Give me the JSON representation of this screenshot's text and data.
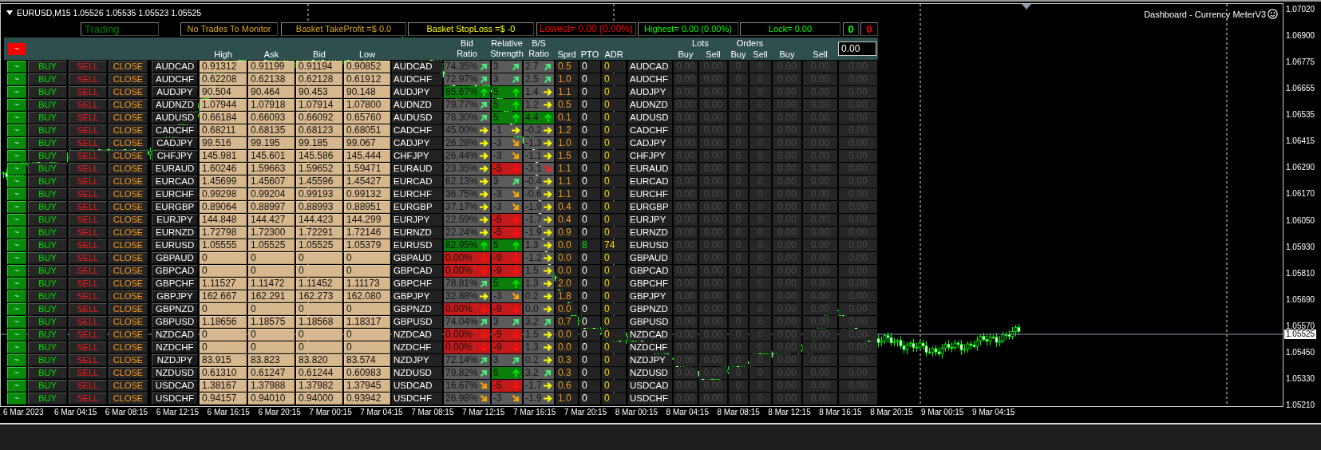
{
  "title": "EURUSD,M15 1.05526 1.05535 1.05523 1.05525",
  "indicator_label": "Dashboard - Currency MeterV3",
  "status": [
    {
      "text": "Trading",
      "color": "#008000"
    },
    {
      "text": "No Trades To Monitor",
      "color": "#d9a520"
    },
    {
      "text": "Basket TakeProfit =$ 0.0",
      "color": "#d9a520"
    },
    {
      "text": "Basket StopLoss =$ -0",
      "color": "#ffff00"
    },
    {
      "text": "Lowest= 0.00 (0.00%)",
      "color": "#ff0000"
    },
    {
      "text": "Highest= 0.00 (0.00%)",
      "color": "#00ff00"
    },
    {
      "text": "Lock= 0.00",
      "color": "#00ff00"
    },
    {
      "text": "0",
      "color": "#00ff00"
    },
    {
      "text": "0",
      "color": "#ff0000"
    }
  ],
  "header": {
    "menu_button": "~",
    "columns": [
      "High",
      "Ask",
      "Bid",
      "Low",
      "Bid Ratio",
      "Relative Strength",
      "B/S Ratio",
      "Sprd",
      "PTO",
      "ADR"
    ],
    "lots": {
      "title": "Lots",
      "columns": [
        "Buy",
        "Sell"
      ]
    },
    "orders": {
      "title": "Orders",
      "columns": [
        "Buy",
        "Sell"
      ]
    },
    "totals": [
      "Buy",
      "Sell"
    ],
    "input_value": "0.00"
  },
  "rows": [
    {
      "buttons": [
        "~",
        "BUY",
        "SELL",
        "CLOSE"
      ],
      "symbol": "AUDCAD",
      "high": "0.91312",
      "ask": "0.91199",
      "bid": "0.91194",
      "low": "0.90852",
      "symbol_2": "AUDCAD",
      "bid_ratio": {
        "text": "74.35%",
        "kind": "rise",
        "color": "#5b5b5b"
      },
      "strength": {
        "text": "3",
        "kind": "rise",
        "color": "#5b5b5b"
      },
      "bs_ratio": {
        "text": "2.7",
        "kind": "rise",
        "color": "#5b5b5b"
      },
      "sprd": "0.5",
      "pto": "0",
      "pto_active": false,
      "adr": "0",
      "symbol_3": "AUDCAD",
      "trades": [
        "0.00",
        "0.00",
        "0",
        "0",
        "0.00",
        "0.00",
        "0.00"
      ]
    },
    {
      "buttons": [
        "~",
        "BUY",
        "SELL",
        "CLOSE"
      ],
      "symbol": "AUDCHF",
      "high": "0.62208",
      "ask": "0.62138",
      "bid": "0.62128",
      "low": "0.61912",
      "symbol_2": "AUDCHF",
      "bid_ratio": {
        "text": "72.97%",
        "kind": "rise",
        "color": "#5b5b5b"
      },
      "strength": {
        "text": "3",
        "kind": "rise",
        "color": "#5b5b5b"
      },
      "bs_ratio": {
        "text": "2.5",
        "kind": "rise",
        "color": "#5b5b5b"
      },
      "sprd": "1.0",
      "pto": "0",
      "pto_active": false,
      "adr": "0",
      "symbol_3": "AUDCHF",
      "trades": [
        "0.00",
        "0.00",
        "0",
        "0",
        "0.00",
        "0.00",
        "0.00"
      ]
    },
    {
      "buttons": [
        "~",
        "BUY",
        "SELL",
        "CLOSE"
      ],
      "symbol": "AUDJPY",
      "high": "90.504",
      "ask": "90.464",
      "bid": "90.453",
      "low": "90.148",
      "symbol_2": "AUDJPY",
      "bid_ratio": {
        "text": "85.67%",
        "kind": "up",
        "color": "#0b7e0b"
      },
      "strength": {
        "text": "5",
        "kind": "up",
        "color": "#0b7e0b"
      },
      "bs_ratio": {
        "text": "1.4",
        "kind": "flat",
        "color": "#5b5b5b"
      },
      "sprd": "1.1",
      "pto": "0",
      "pto_active": false,
      "adr": "0",
      "symbol_3": "AUDJPY",
      "trades": [
        "0.00",
        "0.00",
        "0",
        "0",
        "0.00",
        "0.00",
        "0.00"
      ]
    },
    {
      "buttons": [
        "~",
        "BUY",
        "SELL",
        "CLOSE"
      ],
      "symbol": "AUDNZD",
      "high": "1.07944",
      "ask": "1.07918",
      "bid": "1.07914",
      "low": "1.07800",
      "symbol_2": "AUDNZD",
      "bid_ratio": {
        "text": "79.77%",
        "kind": "rise",
        "color": "#5b5b5b"
      },
      "strength": {
        "text": "5",
        "kind": "up",
        "color": "#0b7e0b"
      },
      "bs_ratio": {
        "text": "1.2",
        "kind": "flat",
        "color": "#5b5b5b"
      },
      "sprd": "0.5",
      "pto": "0",
      "pto_active": false,
      "adr": "0",
      "symbol_3": "AUDNZD",
      "trades": [
        "0.00",
        "0.00",
        "0",
        "0",
        "0.00",
        "0.00",
        "0.00"
      ]
    },
    {
      "buttons": [
        "~",
        "BUY",
        "SELL",
        "CLOSE"
      ],
      "symbol": "AUDUSD",
      "high": "0.66184",
      "ask": "0.66093",
      "bid": "0.66092",
      "low": "0.65760",
      "symbol_2": "AUDUSD",
      "bid_ratio": {
        "text": "78.30%",
        "kind": "rise",
        "color": "#5b5b5b"
      },
      "strength": {
        "text": "5",
        "kind": "up",
        "color": "#0b7e0b"
      },
      "bs_ratio": {
        "text": "4.4",
        "kind": "up",
        "color": "#0b7e0b"
      },
      "sprd": "0.1",
      "pto": "0",
      "pto_active": false,
      "adr": "0",
      "symbol_3": "AUDUSD",
      "trades": [
        "0.00",
        "0.00",
        "0",
        "0",
        "0.00",
        "0.00",
        "0.00"
      ]
    },
    {
      "buttons": [
        "~",
        "BUY",
        "SELL",
        "CLOSE"
      ],
      "symbol": "CADCHF",
      "high": "0.68211",
      "ask": "0.68135",
      "bid": "0.68123",
      "low": "0.68051",
      "symbol_2": "CADCHF",
      "bid_ratio": {
        "text": "45.00%",
        "kind": "flat",
        "color": "#5b5b5b"
      },
      "strength": {
        "text": "-1",
        "kind": "flat",
        "color": "#5b5b5b"
      },
      "bs_ratio": {
        "text": "-0.2",
        "kind": "flat",
        "color": "#5b5b5b"
      },
      "sprd": "1.2",
      "pto": "0",
      "pto_active": false,
      "adr": "0",
      "symbol_3": "CADCHF",
      "trades": [
        "0.00",
        "0.00",
        "0",
        "0",
        "0.00",
        "0.00",
        "0.00"
      ]
    },
    {
      "buttons": [
        "~",
        "BUY",
        "SELL",
        "CLOSE"
      ],
      "symbol": "CADJPY",
      "high": "99.516",
      "ask": "99.195",
      "bid": "99.185",
      "low": "99.067",
      "symbol_2": "CADJPY",
      "bid_ratio": {
        "text": "26.28%",
        "kind": "flat",
        "color": "#5b5b5b"
      },
      "strength": {
        "text": "-3",
        "kind": "ease",
        "color": "#5b5b5b"
      },
      "bs_ratio": {
        "text": "-1.3",
        "kind": "flat",
        "color": "#5b5b5b"
      },
      "sprd": "1.0",
      "pto": "0",
      "pto_active": false,
      "adr": "0",
      "symbol_3": "CADJPY",
      "trades": [
        "0.00",
        "0.00",
        "0",
        "0",
        "0.00",
        "0.00",
        "0.00"
      ]
    },
    {
      "buttons": [
        "~",
        "BUY",
        "SELL",
        "CLOSE"
      ],
      "symbol": "CHFJPY",
      "high": "145.981",
      "ask": "145.601",
      "bid": "145.586",
      "low": "145.444",
      "symbol_2": "CHFJPY",
      "bid_ratio": {
        "text": "26.44%",
        "kind": "flat",
        "color": "#5b5b5b"
      },
      "strength": {
        "text": "-3",
        "kind": "ease",
        "color": "#5b5b5b"
      },
      "bs_ratio": {
        "text": "-1.1",
        "kind": "flat",
        "color": "#5b5b5b"
      },
      "sprd": "1.5",
      "pto": "0",
      "pto_active": false,
      "adr": "0",
      "symbol_3": "CHFJPY",
      "trades": [
        "0.00",
        "0.00",
        "0",
        "0",
        "0.00",
        "0.00",
        "0.00"
      ]
    },
    {
      "buttons": [
        "~",
        "BUY",
        "SELL",
        "CLOSE"
      ],
      "symbol": "EURAUD",
      "high": "1.60246",
      "ask": "1.59663",
      "bid": "1.59652",
      "low": "1.59471",
      "symbol_2": "EURAUD",
      "bid_ratio": {
        "text": "23.35%",
        "kind": "flat",
        "color": "#5b5b5b"
      },
      "strength": {
        "text": "-5",
        "kind": "down",
        "color": "#c41a1a"
      },
      "bs_ratio": {
        "text": "-3.1",
        "kind": "fall",
        "color": "#5b5b5b"
      },
      "sprd": "1.1",
      "pto": "0",
      "pto_active": false,
      "adr": "0",
      "symbol_3": "EURAUD",
      "trades": [
        "0.00",
        "0.00",
        "0",
        "0",
        "0.00",
        "0.00",
        "0.00"
      ]
    },
    {
      "buttons": [
        "~",
        "BUY",
        "SELL",
        "CLOSE"
      ],
      "symbol": "EURCAD",
      "high": "1.45699",
      "ask": "1.45607",
      "bid": "1.45596",
      "low": "1.45427",
      "symbol_2": "EURCAD",
      "bid_ratio": {
        "text": "62.13%",
        "kind": "flat",
        "color": "#5b5b5b"
      },
      "strength": {
        "text": "3",
        "kind": "rise",
        "color": "#5b5b5b"
      },
      "bs_ratio": {
        "text": "-0.4",
        "kind": "flat",
        "color": "#5b5b5b"
      },
      "sprd": "1.1",
      "pto": "0",
      "pto_active": false,
      "adr": "0",
      "symbol_3": "EURCAD",
      "trades": [
        "0.00",
        "0.00",
        "0",
        "0",
        "0.00",
        "0.00",
        "0.00"
      ]
    },
    {
      "buttons": [
        "~",
        "BUY",
        "SELL",
        "CLOSE"
      ],
      "symbol": "EURCHF",
      "high": "0.99298",
      "ask": "0.99204",
      "bid": "0.99193",
      "low": "0.99132",
      "symbol_2": "EURCHF",
      "bid_ratio": {
        "text": "36.75%",
        "kind": "flat",
        "color": "#5b5b5b"
      },
      "strength": {
        "text": "-3",
        "kind": "ease",
        "color": "#5b5b5b"
      },
      "bs_ratio": {
        "text": "-0.6",
        "kind": "flat",
        "color": "#5b5b5b"
      },
      "sprd": "1.1",
      "pto": "0",
      "pto_active": false,
      "adr": "0",
      "symbol_3": "EURCHF",
      "trades": [
        "0.00",
        "0.00",
        "0",
        "0",
        "0.00",
        "0.00",
        "0.00"
      ]
    },
    {
      "buttons": [
        "~",
        "BUY",
        "SELL",
        "CLOSE"
      ],
      "symbol": "EURGBP",
      "high": "0.89064",
      "ask": "0.88997",
      "bid": "0.88993",
      "low": "0.88951",
      "symbol_2": "EURGBP",
      "bid_ratio": {
        "text": "37.17%",
        "kind": "flat",
        "color": "#5b5b5b"
      },
      "strength": {
        "text": "-3",
        "kind": "ease",
        "color": "#5b5b5b"
      },
      "bs_ratio": {
        "text": "-1.9",
        "kind": "flat",
        "color": "#5b5b5b"
      },
      "sprd": "0.4",
      "pto": "0",
      "pto_active": false,
      "adr": "0",
      "symbol_3": "EURGBP",
      "trades": [
        "0.00",
        "0.00",
        "0",
        "0",
        "0.00",
        "0.00",
        "0.00"
      ]
    },
    {
      "buttons": [
        "~",
        "BUY",
        "SELL",
        "CLOSE"
      ],
      "symbol": "EURJPY",
      "high": "144.848",
      "ask": "144.427",
      "bid": "144.423",
      "low": "144.299",
      "symbol_2": "EURJPY",
      "bid_ratio": {
        "text": "22.59%",
        "kind": "flat",
        "color": "#5b5b5b"
      },
      "strength": {
        "text": "-5",
        "kind": "down",
        "color": "#c41a1a"
      },
      "bs_ratio": {
        "text": "-1.7",
        "kind": "flat",
        "color": "#5b5b5b"
      },
      "sprd": "0.4",
      "pto": "0",
      "pto_active": false,
      "adr": "0",
      "symbol_3": "EURJPY",
      "trades": [
        "0.00",
        "0.00",
        "0",
        "0",
        "0.00",
        "0.00",
        "0.00"
      ]
    },
    {
      "buttons": [
        "~",
        "BUY",
        "SELL",
        "CLOSE"
      ],
      "symbol": "EURNZD",
      "high": "1.72798",
      "ask": "1.72300",
      "bid": "1.72291",
      "low": "1.72146",
      "symbol_2": "EURNZD",
      "bid_ratio": {
        "text": "22.24%",
        "kind": "flat",
        "color": "#5b5b5b"
      },
      "strength": {
        "text": "-5",
        "kind": "down",
        "color": "#c41a1a"
      },
      "bs_ratio": {
        "text": "-1.9",
        "kind": "flat",
        "color": "#5b5b5b"
      },
      "sprd": "0.9",
      "pto": "0",
      "pto_active": false,
      "adr": "0",
      "symbol_3": "EURNZD",
      "trades": [
        "0.00",
        "0.00",
        "0",
        "0",
        "0.00",
        "0.00",
        "0.00"
      ]
    },
    {
      "buttons": [
        "~",
        "BUY",
        "SELL",
        "CLOSE"
      ],
      "symbol": "EURUSD",
      "high": "1.05555",
      "ask": "1.05525",
      "bid": "1.05525",
      "low": "1.05379",
      "symbol_2": "EURUSD",
      "bid_ratio": {
        "text": "82.95%",
        "kind": "up",
        "color": "#0b7e0b"
      },
      "strength": {
        "text": "5",
        "kind": "up",
        "color": "#0b7e0b"
      },
      "bs_ratio": {
        "text": "1.3",
        "kind": "flat",
        "color": "#5b5b5b"
      },
      "sprd": "0.0",
      "pto": "8",
      "pto_active": true,
      "adr": "74",
      "symbol_3": "EURUSD",
      "trades": [
        "0.00",
        "0.00",
        "0",
        "0",
        "0.00",
        "0.00",
        "0.00"
      ]
    },
    {
      "buttons": [
        "~",
        "BUY",
        "SELL",
        "CLOSE"
      ],
      "symbol": "GBPAUD",
      "high": "0",
      "ask": "0",
      "bid": "0",
      "low": "0",
      "symbol_2": "GBPAUD",
      "bid_ratio": {
        "text": "0.00%",
        "kind": "down",
        "color": "#c41a1a"
      },
      "strength": {
        "text": "-9",
        "kind": "down",
        "color": "#c41a1a"
      },
      "bs_ratio": {
        "text": "-1.2",
        "kind": "flat",
        "color": "#5b5b5b"
      },
      "sprd": "0.0",
      "pto": "0",
      "pto_active": false,
      "adr": "0",
      "symbol_3": "GBPAUD",
      "trades": [
        "0.00",
        "0.00",
        "0",
        "0",
        "0.00",
        "0.00",
        "0.00"
      ]
    },
    {
      "buttons": [
        "~",
        "BUY",
        "SELL",
        "CLOSE"
      ],
      "symbol": "GBPCAD",
      "high": "0",
      "ask": "0",
      "bid": "0",
      "low": "0",
      "symbol_2": "GBPCAD",
      "bid_ratio": {
        "text": "0.00%",
        "kind": "down",
        "color": "#c41a1a"
      },
      "strength": {
        "text": "-9",
        "kind": "down",
        "color": "#c41a1a"
      },
      "bs_ratio": {
        "text": "1.5",
        "kind": "flat",
        "color": "#5b5b5b"
      },
      "sprd": "0.0",
      "pto": "0",
      "pto_active": false,
      "adr": "0",
      "symbol_3": "GBPCAD",
      "trades": [
        "0.00",
        "0.00",
        "0",
        "0",
        "0.00",
        "0.00",
        "0.00"
      ]
    },
    {
      "buttons": [
        "~",
        "BUY",
        "SELL",
        "CLOSE"
      ],
      "symbol": "GBPCHF",
      "high": "1.11527",
      "ask": "1.11472",
      "bid": "1.11452",
      "low": "1.11173",
      "symbol_2": "GBPCHF",
      "bid_ratio": {
        "text": "78.81%",
        "kind": "rise",
        "color": "#5b5b5b"
      },
      "strength": {
        "text": "5",
        "kind": "up",
        "color": "#0b7e0b"
      },
      "bs_ratio": {
        "text": "1.3",
        "kind": "flat",
        "color": "#5b5b5b"
      },
      "sprd": "2.0",
      "pto": "0",
      "pto_active": false,
      "adr": "0",
      "symbol_3": "GBPCHF",
      "trades": [
        "0.00",
        "0.00",
        "0",
        "0",
        "0.00",
        "0.00",
        "0.00"
      ]
    },
    {
      "buttons": [
        "~",
        "BUY",
        "SELL",
        "CLOSE"
      ],
      "symbol": "GBPJPY",
      "high": "162.667",
      "ask": "162.291",
      "bid": "162.273",
      "low": "162.080",
      "symbol_2": "GBPJPY",
      "bid_ratio": {
        "text": "32.88%",
        "kind": "flat",
        "color": "#5b5b5b"
      },
      "strength": {
        "text": "-3",
        "kind": "ease",
        "color": "#5b5b5b"
      },
      "bs_ratio": {
        "text": "0.2",
        "kind": "flat",
        "color": "#5b5b5b"
      },
      "sprd": "1.8",
      "pto": "0",
      "pto_active": false,
      "adr": "0",
      "symbol_3": "GBPJPY",
      "trades": [
        "0.00",
        "0.00",
        "0",
        "0",
        "0.00",
        "0.00",
        "0.00"
      ]
    },
    {
      "buttons": [
        "~",
        "BUY",
        "SELL",
        "CLOSE"
      ],
      "symbol": "GBPNZD",
      "high": "0",
      "ask": "0",
      "bid": "0",
      "low": "0",
      "symbol_2": "GBPNZD",
      "bid_ratio": {
        "text": "0.00%",
        "kind": "down",
        "color": "#c41a1a"
      },
      "strength": {
        "text": "-9",
        "kind": "down",
        "color": "#c41a1a"
      },
      "bs_ratio": {
        "text": "0.0",
        "kind": "flat",
        "color": "#5b5b5b"
      },
      "sprd": "0.0",
      "pto": "0",
      "pto_active": false,
      "adr": "0",
      "symbol_3": "GBPNZD",
      "trades": [
        "0.00",
        "0.00",
        "0",
        "0",
        "0.00",
        "0.00",
        "0.00"
      ]
    },
    {
      "buttons": [
        "~",
        "BUY",
        "SELL",
        "CLOSE"
      ],
      "symbol": "GBPUSD",
      "high": "1.18656",
      "ask": "1.18575",
      "bid": "1.18568",
      "low": "1.18317",
      "symbol_2": "GBPUSD",
      "bid_ratio": {
        "text": "74.04%",
        "kind": "rise",
        "color": "#5b5b5b"
      },
      "strength": {
        "text": "3",
        "kind": "rise",
        "color": "#5b5b5b"
      },
      "bs_ratio": {
        "text": "3.2",
        "kind": "rise",
        "color": "#5b5b5b"
      },
      "sprd": "0.7",
      "pto": "0",
      "pto_active": false,
      "adr": "0",
      "symbol_3": "GBPUSD",
      "trades": [
        "0.00",
        "0.00",
        "0",
        "0",
        "0.00",
        "0.00",
        "0.00"
      ]
    },
    {
      "buttons": [
        "~",
        "BUY",
        "SELL",
        "CLOSE"
      ],
      "symbol": "NZDCAD",
      "high": "0",
      "ask": "0",
      "bid": "0",
      "low": "0",
      "symbol_2": "NZDCAD",
      "bid_ratio": {
        "text": "0.00%",
        "kind": "down",
        "color": "#c41a1a"
      },
      "strength": {
        "text": "-9",
        "kind": "down",
        "color": "#c41a1a"
      },
      "bs_ratio": {
        "text": "1.5",
        "kind": "flat",
        "color": "#5b5b5b"
      },
      "sprd": "0.0",
      "pto": "0",
      "pto_active": false,
      "adr": "0",
      "symbol_3": "NZDCAD",
      "trades": [
        "0.00",
        "0.00",
        "0",
        "0",
        "0.00",
        "0.00",
        "0.00"
      ]
    },
    {
      "buttons": [
        "~",
        "BUY",
        "SELL",
        "CLOSE"
      ],
      "symbol": "NZDCHF",
      "high": "0",
      "ask": "0",
      "bid": "0",
      "low": "0",
      "symbol_2": "NZDCHF",
      "bid_ratio": {
        "text": "0.00%",
        "kind": "down",
        "color": "#c41a1a"
      },
      "strength": {
        "text": "-9",
        "kind": "down",
        "color": "#c41a1a"
      },
      "bs_ratio": {
        "text": "1.3",
        "kind": "flat",
        "color": "#5b5b5b"
      },
      "sprd": "0.0",
      "pto": "0",
      "pto_active": false,
      "adr": "0",
      "symbol_3": "NZDCHF",
      "trades": [
        "0.00",
        "0.00",
        "0",
        "0",
        "0.00",
        "0.00",
        "0.00"
      ]
    },
    {
      "buttons": [
        "~",
        "BUY",
        "SELL",
        "CLOSE"
      ],
      "symbol": "NZDJPY",
      "high": "83.915",
      "ask": "83.823",
      "bid": "83.820",
      "low": "83.574",
      "symbol_2": "NZDJPY",
      "bid_ratio": {
        "text": "72.14%",
        "kind": "rise",
        "color": "#5b5b5b"
      },
      "strength": {
        "text": "3",
        "kind": "rise",
        "color": "#5b5b5b"
      },
      "bs_ratio": {
        "text": "0.2",
        "kind": "flat",
        "color": "#5b5b5b"
      },
      "sprd": "0.3",
      "pto": "0",
      "pto_active": false,
      "adr": "0",
      "symbol_3": "NZDJPY",
      "trades": [
        "0.00",
        "0.00",
        "0",
        "0",
        "0.00",
        "0.00",
        "0.00"
      ]
    },
    {
      "buttons": [
        "~",
        "BUY",
        "SELL",
        "CLOSE"
      ],
      "symbol": "NZDUSD",
      "high": "0.61310",
      "ask": "0.61247",
      "bid": "0.61244",
      "low": "0.60983",
      "symbol_2": "NZDUSD",
      "bid_ratio": {
        "text": "79.82%",
        "kind": "rise",
        "color": "#5b5b5b"
      },
      "strength": {
        "text": "5",
        "kind": "up",
        "color": "#0b7e0b"
      },
      "bs_ratio": {
        "text": "3.2",
        "kind": "rise",
        "color": "#5b5b5b"
      },
      "sprd": "0.3",
      "pto": "0",
      "pto_active": false,
      "adr": "0",
      "symbol_3": "NZDUSD",
      "trades": [
        "0.00",
        "0.00",
        "0",
        "0",
        "0.00",
        "0.00",
        "0.00"
      ]
    },
    {
      "buttons": [
        "~",
        "BUY",
        "SELL",
        "CLOSE"
      ],
      "symbol": "USDCAD",
      "high": "1.38167",
      "ask": "1.37988",
      "bid": "1.37982",
      "low": "1.37945",
      "symbol_2": "USDCAD",
      "bid_ratio": {
        "text": "16.67%",
        "kind": "ease",
        "color": "#5b5b5b"
      },
      "strength": {
        "text": "-5",
        "kind": "down",
        "color": "#c41a1a"
      },
      "bs_ratio": {
        "text": "-1.7",
        "kind": "flat",
        "color": "#5b5b5b"
      },
      "sprd": "0.6",
      "pto": "0",
      "pto_active": false,
      "adr": "0",
      "symbol_3": "USDCAD",
      "trades": [
        "0.00",
        "0.00",
        "0",
        "0",
        "0.00",
        "0.00",
        "0.00"
      ]
    },
    {
      "buttons": [
        "~",
        "BUY",
        "SELL",
        "CLOSE"
      ],
      "symbol": "USDCHF",
      "high": "0.94157",
      "ask": "0.94010",
      "bid": "0.94000",
      "low": "0.93942",
      "symbol_2": "USDCHF",
      "bid_ratio": {
        "text": "26.98%",
        "kind": "ease",
        "color": "#5b5b5b"
      },
      "strength": {
        "text": "-3",
        "kind": "ease",
        "color": "#5b5b5b"
      },
      "bs_ratio": {
        "text": "-1.9",
        "kind": "flat",
        "color": "#5b5b5b"
      },
      "sprd": "1.0",
      "pto": "0",
      "pto_active": false,
      "adr": "0",
      "symbol_3": "USDCHF",
      "trades": [
        "0.00",
        "0.00",
        "0",
        "0",
        "0.00",
        "0.00",
        "0.00"
      ]
    }
  ],
  "price_axis": [
    "1.07020",
    "1.06900",
    "1.06775",
    "1.06655",
    "1.06535",
    "1.06415",
    "1.06290",
    "1.06170",
    "1.06050",
    "1.05930",
    "1.05810",
    "1.05690",
    "1.05570",
    "1.05450",
    "1.05330",
    "1.05210"
  ],
  "current_price": "1.05525",
  "time_axis": [
    "6 Mar 2023",
    "6 Mar 04:15",
    "6 Mar 08:15",
    "6 Mar 12:15",
    "6 Mar 16:15",
    "6 Mar 20:15",
    "7 Mar 00:15",
    "7 Mar 04:15",
    "7 Mar 08:15",
    "7 Mar 12:15",
    "7 Mar 16:15",
    "7 Mar 20:15",
    "8 Mar 00:15",
    "8 Mar 04:15",
    "8 Mar 08:15",
    "8 Mar 12:15",
    "8 Mar 16:15",
    "8 Mar 20:15",
    "9 Mar 00:15",
    "9 Mar 04:15"
  ]
}
